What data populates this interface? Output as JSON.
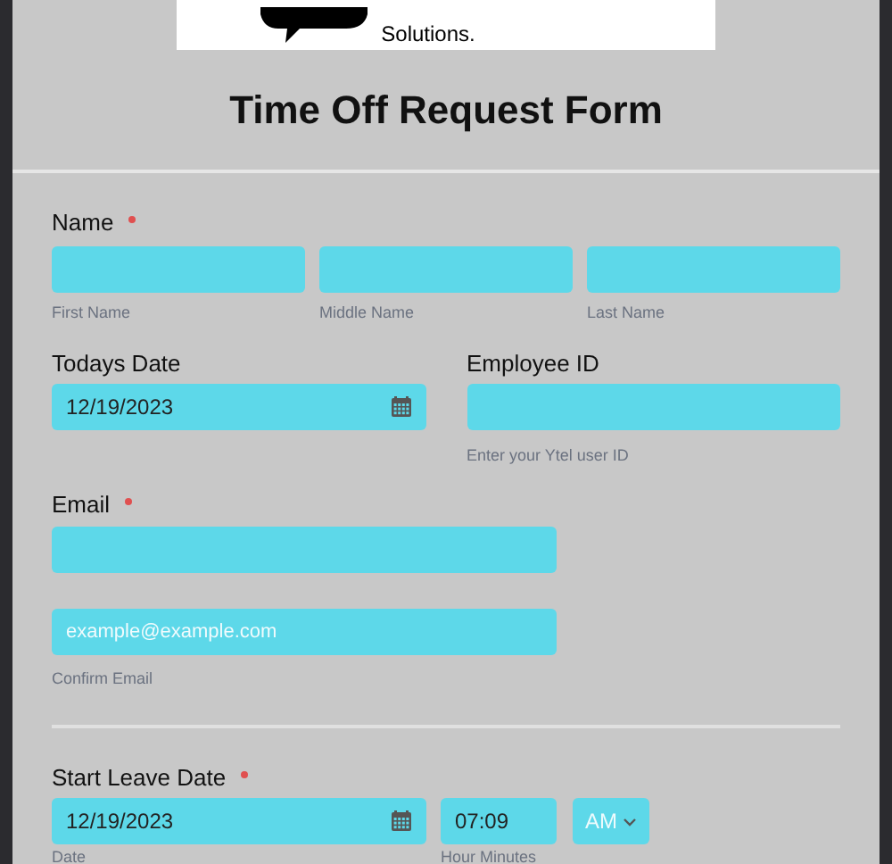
{
  "logo": {
    "tagline": "Solutions."
  },
  "title": "Time Off Request Form",
  "name_field": {
    "label": "Name",
    "required": true,
    "parts": [
      {
        "sublabel": "First Name"
      },
      {
        "sublabel": "Middle Name"
      },
      {
        "sublabel": "Last Name"
      }
    ]
  },
  "todays_date": {
    "label": "Todays Date",
    "value": "12/19/2023"
  },
  "employee_id": {
    "label": "Employee ID",
    "hint": "Enter your Ytel user ID"
  },
  "email": {
    "label": "Email",
    "required": true,
    "confirm_placeholder": "example@example.com",
    "confirm_sublabel": "Confirm Email"
  },
  "start_leave": {
    "label": "Start Leave Date",
    "required": true,
    "date": "12/19/2023",
    "time": "07:09",
    "period": "AM",
    "date_sublabel": "Date",
    "time_sublabel": "Hour Minutes"
  }
}
